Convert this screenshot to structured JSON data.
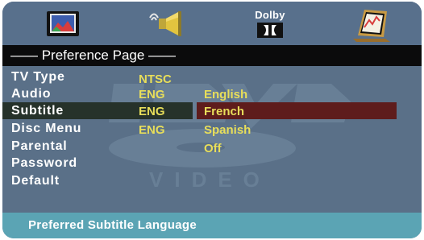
{
  "toolbar": {
    "icons": [
      {
        "name": "general-setup-icon"
      },
      {
        "name": "audio-setup-icon"
      },
      {
        "name": "dolby-setup-icon",
        "label": "Dolby"
      },
      {
        "name": "preference-setup-icon"
      }
    ]
  },
  "header": {
    "title": "—— Preference Page ——"
  },
  "menu": {
    "items": [
      {
        "label": "TV Type"
      },
      {
        "label": "Audio"
      },
      {
        "label": "Subtitle"
      },
      {
        "label": "Disc Menu"
      },
      {
        "label": "Parental"
      },
      {
        "label": "Password"
      },
      {
        "label": "Default"
      }
    ],
    "values": [
      "NTSC",
      "ENG",
      "ENG",
      "ENG"
    ],
    "selected_item": "Subtitle"
  },
  "options": {
    "items": [
      "English",
      "French",
      "Spanish",
      "Off"
    ],
    "selected": "French"
  },
  "watermark": {
    "text": "VIDEO"
  },
  "footer": {
    "hint": "Preferred Subtitle Language"
  },
  "colors": {
    "background": "#58708c",
    "value_text": "#e8de5a",
    "selected_menu": "#26322a",
    "selected_option": "#5e1c1c",
    "footer": "#5ba4b4",
    "header": "#0b0b0c"
  }
}
